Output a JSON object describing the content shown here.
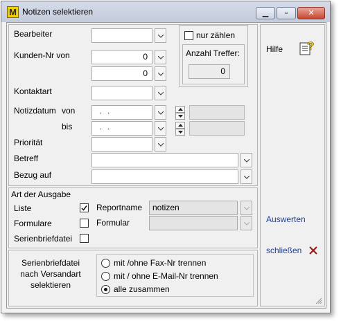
{
  "window": {
    "title": "Notizen selektieren",
    "app_icon": "M"
  },
  "fields": {
    "bearbeiter": "Bearbeiter",
    "kunden_nr_von": "Kunden-Nr von",
    "kunden_von_value": "0",
    "kunden_bis_value": "0",
    "kontaktart": "Kontaktart",
    "notizdatum": "Notizdatum",
    "von": "von",
    "bis": "bis",
    "date_placeholder": ". .",
    "prioritaet": "Priorität",
    "betreff": "Betreff",
    "bezug_auf": "Bezug auf"
  },
  "count_box": {
    "nur_zaehlen": "nur zählen",
    "anzahl_treffer": "Anzahl Treffer:",
    "anzahl_value": "0"
  },
  "ausgabe": {
    "title": "Art der Ausgabe",
    "liste": "Liste",
    "formulare": "Formulare",
    "serienbriefdatei": "Serienbriefdatei",
    "reportname": "Reportname",
    "reportname_value": "notizen",
    "formular": "Formular"
  },
  "versand": {
    "label_line1": "Serienbriefdatei",
    "label_line2": "nach Versandart",
    "label_line3": "selektieren",
    "options": [
      "mit /ohne Fax-Nr trennen",
      "mit / ohne E-Mail-Nr trennen",
      "alle zusammen"
    ],
    "selected_index": 2
  },
  "side": {
    "hilfe": "Hilfe",
    "auswerten": "Auswerten",
    "schliessen": "schließen"
  },
  "colors": {
    "close_x": "#a01818",
    "link": "#1f3f9a",
    "help_icon_yellow": "#f2d21b"
  }
}
